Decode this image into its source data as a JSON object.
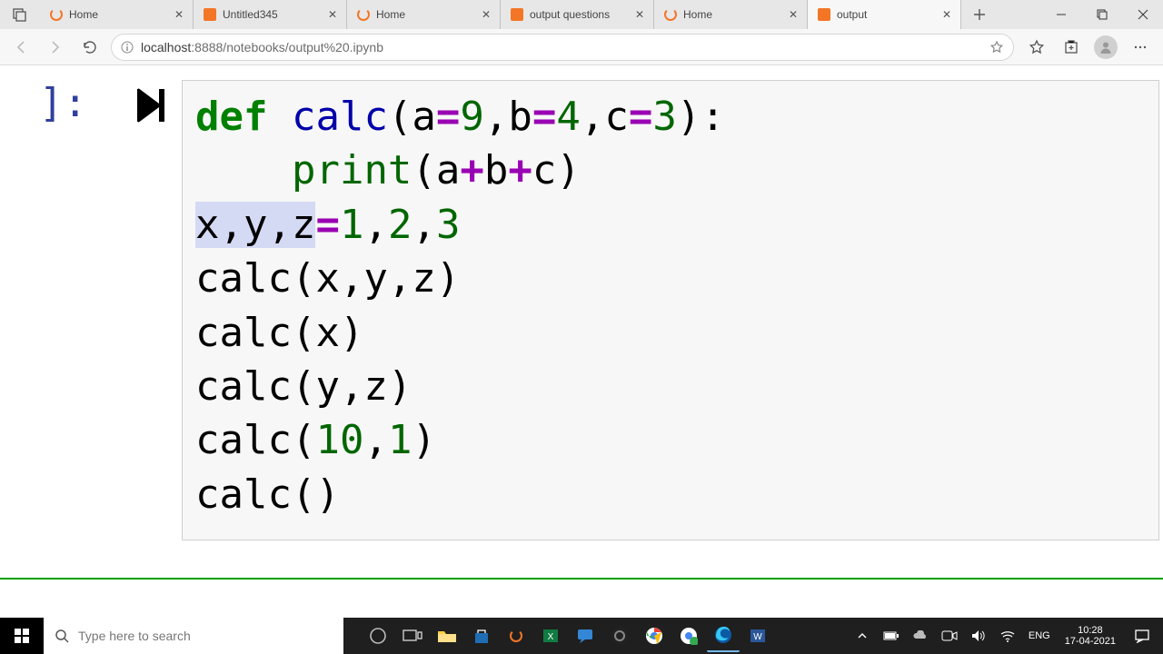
{
  "browser": {
    "tabs": [
      {
        "title": "Home",
        "icon": "jupyter-spinner"
      },
      {
        "title": "Untitled345",
        "icon": "jupyter-book"
      },
      {
        "title": "Home",
        "icon": "jupyter-spinner"
      },
      {
        "title": "output questions",
        "icon": "jupyter-book"
      },
      {
        "title": "Home",
        "icon": "jupyter-spinner"
      },
      {
        "title": "output",
        "icon": "jupyter-book",
        "active": true
      }
    ],
    "url_host": "localhost",
    "url_path": ":8888/notebooks/output%20.ipynb"
  },
  "notebook": {
    "prompt": "]:",
    "code": {
      "line1_def": "def",
      "line1_fn": " calc",
      "line1_sig_a": "(a",
      "line1_op1": "=",
      "line1_n1": "9",
      "line1_c1": ",b",
      "line1_op2": "=",
      "line1_n2": "4",
      "line1_c2": ",c",
      "line1_op3": "=",
      "line1_n3": "3",
      "line1_end": "):",
      "line2_indent": "    ",
      "line2_print": "print",
      "line2_open": "(a",
      "line2_plus1": "+",
      "line2_b": "b",
      "line2_plus2": "+",
      "line2_c": "c)",
      "line3_sel": "x,y,z",
      "line3_op": "=",
      "line3_n1": "1",
      "line3_c1": ",",
      "line3_n2": "2",
      "line3_c2": ",",
      "line3_n3": "3",
      "line4": "calc(x,y,z)",
      "line5": "calc(x)",
      "line6": "calc(y,z)",
      "line7_pre": "calc(",
      "line7_n1": "10",
      "line7_c": ",",
      "line7_n2": "1",
      "line7_post": ")",
      "line8": "calc()"
    }
  },
  "taskbar": {
    "search_placeholder": "Type here to search",
    "lang": "ENG",
    "time": "10:28",
    "date": "17-04-2021"
  }
}
